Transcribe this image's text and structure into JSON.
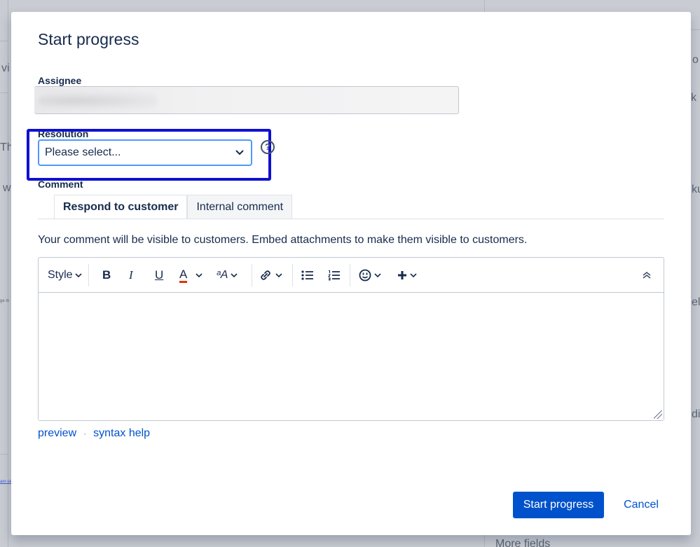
{
  "background": {
    "fragments": [
      "vi",
      "Tho",
      "w",
      "o",
      "k a",
      "ku",
      "ela",
      "diu",
      "More fields"
    ],
    "tiny_fragments": [
      "ge in",
      "am-se"
    ]
  },
  "dialog": {
    "title": "Start progress",
    "assignee": {
      "label": "Assignee",
      "value": ""
    },
    "resolution": {
      "label": "Resolution",
      "selected": "Please select..."
    },
    "comment": {
      "label": "Comment",
      "tabs": [
        {
          "label": "Respond to customer",
          "active": true
        },
        {
          "label": "Internal comment",
          "active": false
        }
      ],
      "info": "Your comment will be visible to customers. Embed attachments to make them visible to customers.",
      "toolbar": {
        "style_label": "Style",
        "bold": "B",
        "italic": "I",
        "underline": "U",
        "text_color": "A",
        "text_size": "ᵃA"
      },
      "body": ""
    },
    "links": {
      "preview": "preview",
      "separator": "·",
      "syntax_help": "syntax help"
    },
    "buttons": {
      "submit": "Start progress",
      "cancel": "Cancel"
    }
  },
  "colors": {
    "primary": "#0052cc",
    "highlight_box": "#1010d0",
    "focus_border": "#4c9aff",
    "text_color_bar": "#de350b"
  }
}
